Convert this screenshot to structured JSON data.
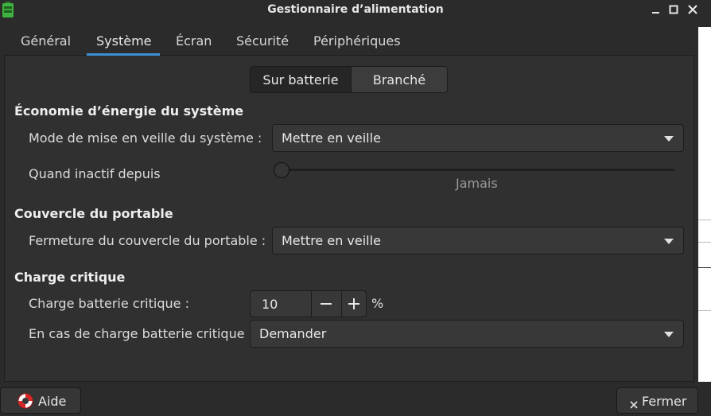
{
  "window": {
    "title": "Gestionnaire d’alimentation",
    "icon": "battery-icon",
    "controls": [
      "minimize-icon",
      "maximize-icon",
      "close-icon"
    ]
  },
  "tabs": [
    {
      "label": "Général",
      "active": false
    },
    {
      "label": "Système",
      "active": true
    },
    {
      "label": "Écran",
      "active": false
    },
    {
      "label": "Sécurité",
      "active": false
    },
    {
      "label": "Périphériques",
      "active": false
    }
  ],
  "power_source": {
    "options": [
      "Sur batterie",
      "Branché"
    ],
    "selected": "Sur batterie"
  },
  "economy": {
    "heading": "Économie d’énergie du système",
    "sleep_mode_label": "Mode de mise en veille du système :",
    "sleep_mode_value": "Mettre en veille",
    "inactive_label": "Quand inactif depuis",
    "inactive_value": "Jamais",
    "inactive_slider_fraction": 0
  },
  "lid": {
    "heading": "Couvercle du portable",
    "close_label": "Fermeture du couvercle du portable :",
    "close_value": "Mettre en veille"
  },
  "critical": {
    "heading": "Charge critique",
    "level_label": "Charge batterie critique :",
    "level_value": "10",
    "level_unit": "%",
    "action_label": "En cas de charge batterie critique :",
    "action_value": "Demander"
  },
  "footer": {
    "help_label": "Aide",
    "help_icon": "lifebuoy-icon",
    "close_label": "Fermer",
    "close_icon": "close-icon"
  },
  "colors": {
    "accent": "#3d8fd1",
    "battery_icon": "#3fb23f"
  }
}
